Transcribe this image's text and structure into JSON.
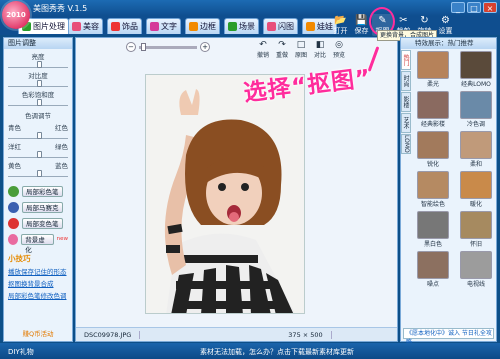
{
  "app": {
    "title": "美图秀秀 V.1.5",
    "logo_text": "2010"
  },
  "window_controls": [
    "_",
    "□",
    "×"
  ],
  "tabs": [
    {
      "label": "图片处理",
      "color": "#2a9d2a"
    },
    {
      "label": "美容",
      "color": "#e84f7a"
    },
    {
      "label": "饰品",
      "color": "#e33"
    },
    {
      "label": "文字",
      "color": "#d53a9a"
    },
    {
      "label": "边框",
      "color": "#f28a00"
    },
    {
      "label": "场景",
      "color": "#2a9d2a"
    },
    {
      "label": "闪图",
      "color": "#e84f7a"
    },
    {
      "label": "娃娃",
      "color": "#f28a00"
    }
  ],
  "toolbar": [
    {
      "label": "打开",
      "icon": "open-icon",
      "glyph": "📂"
    },
    {
      "label": "保存",
      "icon": "save-icon",
      "glyph": "💾"
    },
    {
      "label": "抠图",
      "icon": "cutout-icon",
      "glyph": "✎"
    },
    {
      "label": "裁剪",
      "icon": "crop-icon",
      "glyph": "✂"
    },
    {
      "label": "旋转",
      "icon": "rotate-icon",
      "glyph": "↻"
    },
    {
      "label": "设置",
      "icon": "settings-icon",
      "glyph": "⚙"
    }
  ],
  "tooltip": "更换背景，合成图片",
  "annotation": "选择“抠图”",
  "left": {
    "header": "图片调整",
    "sliders": [
      {
        "label": "亮度",
        "value": 0.5
      },
      {
        "label": "对比度",
        "value": 0.5
      },
      {
        "label": "色彩饱和度",
        "value": 0.5
      }
    ],
    "color_header": "色调调节",
    "color_pairs": [
      {
        "left": "青色",
        "right": "红色",
        "value": 0.5
      },
      {
        "left": "洋红",
        "right": "绿色",
        "value": 0.5
      },
      {
        "left": "黄色",
        "right": "蓝色",
        "value": 0.5
      }
    ],
    "effects": [
      {
        "label": "局部彩色笔",
        "color": "#4a9d3a"
      },
      {
        "label": "局部马赛克",
        "color": "#3a5fb0"
      },
      {
        "label": "局部变色笔",
        "color": "#d33"
      },
      {
        "label": "背景虚化",
        "color": "#e96aa0",
        "badge": "new"
      }
    ],
    "tips_title": "小技巧",
    "tips": [
      "播放保存记住的形态",
      "抠图换背景合成",
      "局部彩色笔修改色调"
    ],
    "footer": "赚Q币活动"
  },
  "center": {
    "zoom_minus": "−",
    "zoom_plus": "+",
    "tools": [
      {
        "label": "撤销",
        "glyph": "↶"
      },
      {
        "label": "重做",
        "glyph": "↷"
      },
      {
        "label": "原图",
        "glyph": "□"
      },
      {
        "label": "对比",
        "glyph": "◧"
      },
      {
        "label": "预览",
        "glyph": "◎"
      }
    ],
    "photo_tools": [
      "撤销",
      "重做",
      "原图",
      "对比",
      "预览"
    ],
    "status": {
      "filename": "DSC09978.JPG",
      "size": "375 × 500"
    }
  },
  "right": {
    "header": "特效展示：热门推荐",
    "vtabs": [
      "热门",
      "时尚",
      "影楼",
      "艺术",
      "LOMO"
    ],
    "thumbs": [
      {
        "label": "柔光",
        "color": "#b6825a"
      },
      {
        "label": "经典LOMO",
        "color": "#5a4a3a"
      },
      {
        "label": "经典影楼",
        "color": "#8a6a60"
      },
      {
        "label": "冷色调",
        "color": "#6a8aa8"
      },
      {
        "label": "锐化",
        "color": "#a27a5c"
      },
      {
        "label": "柔和",
        "color": "#c09a7a"
      },
      {
        "label": "智能绘色",
        "color": "#b58a62"
      },
      {
        "label": "暖化",
        "color": "#c98a4a"
      },
      {
        "label": "黑白色",
        "color": "#777777"
      },
      {
        "label": "怀旧",
        "color": "#a68a60"
      },
      {
        "label": "噪点",
        "color": "#8c7060"
      },
      {
        "label": "电视线",
        "color": "#9c9c9c"
      }
    ],
    "footer": "《愿本地化中》诚入 节日礼全攻略"
  },
  "bottom": {
    "left": "DIY礼物",
    "center": "素材无法加载，怎么办？点击下载最新素材库更新"
  }
}
